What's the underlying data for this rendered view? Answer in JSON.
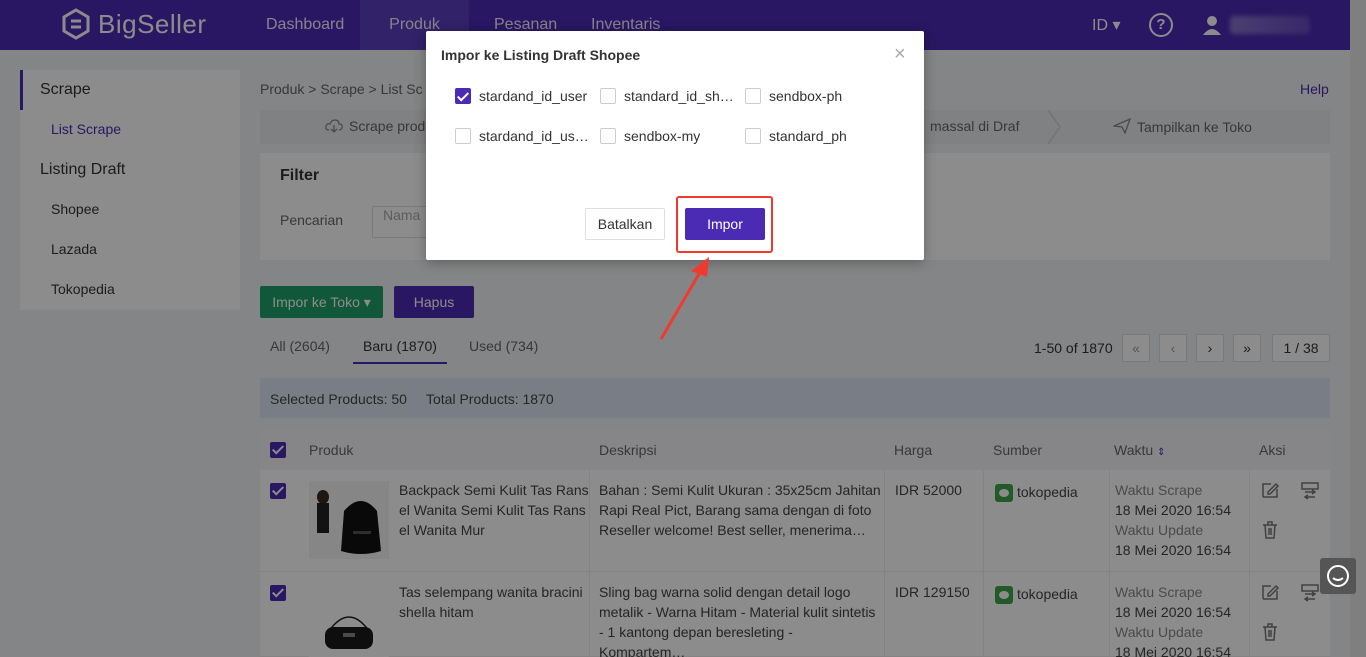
{
  "nav": {
    "brand": "BigSeller",
    "items": [
      "Dashboard",
      "Produk",
      "Pesanan",
      "Inventaris"
    ],
    "lang": "ID ▾"
  },
  "sidebar": {
    "sections": [
      {
        "label": "Scrape",
        "items": [
          "List Scrape"
        ]
      },
      {
        "label": "Listing Draft",
        "items": [
          "Shopee",
          "Lazada",
          "Tokopedia"
        ]
      }
    ]
  },
  "breadcrumb": "Produk  >  Scrape  >  List Sc",
  "help": "Help",
  "steps": [
    "Scrape prod",
    "massal di Draf",
    "Tampilkan ke Toko"
  ],
  "filter": {
    "title": "Filter",
    "label": "Pencarian",
    "placeholder": "Nama"
  },
  "buttons": {
    "import_store": "Impor ke Toko",
    "delete": "Hapus"
  },
  "tabs": [
    {
      "label": "All",
      "count": "(2604)"
    },
    {
      "label": "Baru",
      "count": "(1870)"
    },
    {
      "label": "Used",
      "count": "(734)"
    }
  ],
  "pager": {
    "range": "1-50 of 1870",
    "page": "1 / 38"
  },
  "selection": {
    "selected": "Selected Products: 50",
    "total": "Total Products: 1870"
  },
  "table": {
    "headers": {
      "product": "Produk",
      "desc": "Deskripsi",
      "price": "Harga",
      "source": "Sumber",
      "time": "Waktu",
      "action": "Aksi"
    },
    "rows": [
      {
        "name": "Backpack Semi Kulit Tas Rans el Wanita Semi Kulit Tas Rans el Wanita Mur",
        "desc": "Bahan : Semi Kulit Ukuran : 35x25cm Jahitan Rapi Real Pict, Barang sama dengan di foto Reseller welcome! Best seller, menerima…",
        "price": "IDR 52000",
        "source": "tokopedia",
        "scrape_label": "Waktu Scrape",
        "scrape_time": "18 Mei 2020 16:54",
        "update_label": "Waktu Update",
        "update_time": "18 Mei 2020 16:54"
      },
      {
        "name": "Tas selempang wanita bracini shella hitam",
        "desc": "Sling bag warna solid dengan detail logo metalik - Warna Hitam - Material kulit sintetis - 1 kantong depan beresleting - Kompartem…",
        "price": "IDR 129150",
        "source": "tokopedia",
        "scrape_label": "Waktu Scrape",
        "scrape_time": "18 Mei 2020 16:54",
        "update_label": "Waktu Update",
        "update_time": "18 Mei 2020 16:54"
      }
    ]
  },
  "modal": {
    "title": "Impor ke Listing Draft Shopee",
    "options": [
      {
        "label": "stardand_id_user",
        "checked": true
      },
      {
        "label": "standard_id_sho…",
        "checked": false
      },
      {
        "label": "sendbox-ph",
        "checked": false
      },
      {
        "label": "stardand_id_user…",
        "checked": false
      },
      {
        "label": "sendbox-my",
        "checked": false
      },
      {
        "label": "standard_ph",
        "checked": false
      }
    ],
    "cancel": "Batalkan",
    "confirm": "Impor"
  },
  "colors": {
    "brand": "#4b2ab4",
    "green": "#1f9e6a",
    "annotation": "#f03a2e"
  }
}
